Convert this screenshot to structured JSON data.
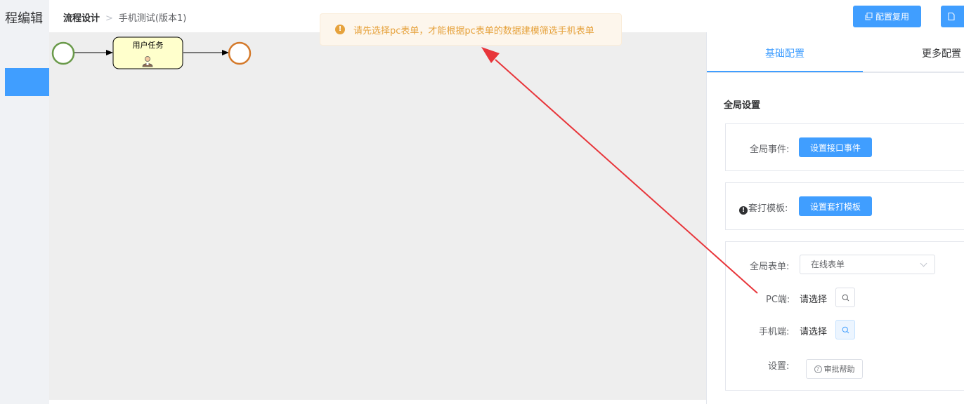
{
  "left": {
    "title": "程编辑"
  },
  "breadcrumb": {
    "first": "流程设计",
    "separator": ">",
    "current": "手机测试(版本1)"
  },
  "header": {
    "reuse_label": "配置复用"
  },
  "toast": {
    "message": "请先选择pc表单，才能根据pc表单的数据建模筛选手机表单",
    "icon": "warning-icon"
  },
  "canvas": {
    "task_label": "用户任务",
    "task_icon": "user-icon"
  },
  "tabs": [
    {
      "label": "基础配置"
    },
    {
      "label": "更多配置"
    }
  ],
  "panel": {
    "section_title": "全局设置",
    "global_event": {
      "label": "全局事件:",
      "button": "设置接口事件"
    },
    "print_template": {
      "label": "套打模板:",
      "button": "设置套打模板"
    },
    "global_form": {
      "label": "全局表单:",
      "value": "在线表单"
    },
    "pc": {
      "label": "PC端:",
      "value": "请选择"
    },
    "mobile": {
      "label": "手机端:",
      "value": "请选择"
    },
    "settings": {
      "label": "设置:",
      "button": "审批帮助"
    }
  },
  "colors": {
    "accent": "#409eff",
    "warning": "#e6a23c",
    "start_event": "#6a9a4a",
    "end_event": "#d4792a",
    "annotation": "#e8353a"
  }
}
